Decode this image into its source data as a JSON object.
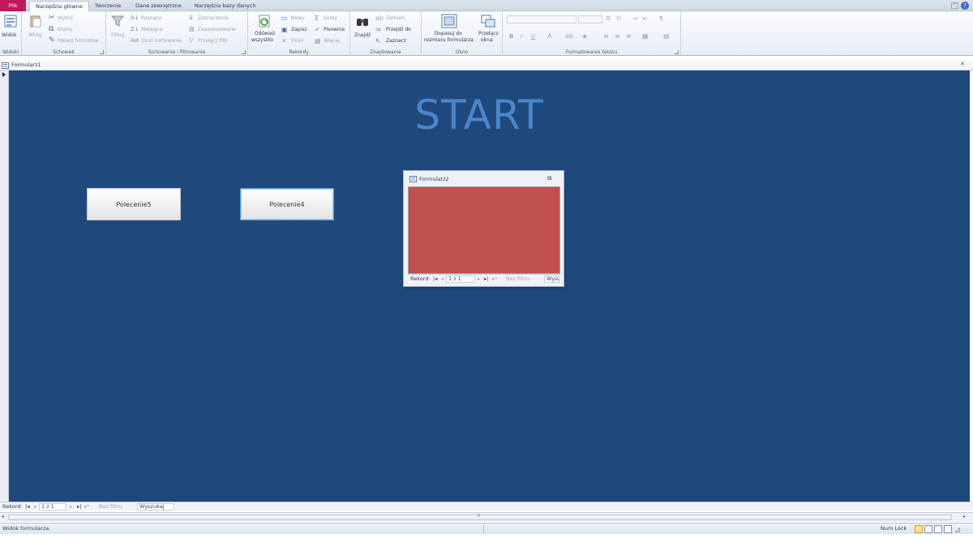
{
  "tabs": {
    "file": "Plik",
    "home": "Narzędzia główne",
    "create": "Tworzenie",
    "external": "Dane zewnętrzne",
    "dbtools": "Narzędzia bazy danych"
  },
  "ribbon": {
    "views": {
      "label": "Widoki",
      "view": "Widok"
    },
    "clipboard": {
      "label": "Schowek",
      "paste": "Wklej",
      "cut": "Wytnij",
      "copy": "Kopiuj",
      "painter": "Malarz formatów"
    },
    "sort": {
      "label": "Sortowanie i filtrowanie",
      "filter": "Filtruj",
      "asc": "Rosnąco",
      "desc": "Malejąco",
      "remove_sort": "Usuń sortowanie",
      "selection": "Zaznaczenie",
      "advanced": "Zaawansowane",
      "toggle": "Przełącz filtr"
    },
    "records": {
      "label": "Rekordy",
      "refresh1": "Odśwież",
      "refresh2": "wszystko",
      "new": "Nowy",
      "save": "Zapisz",
      "delete": "Usuń",
      "totals": "Sumy",
      "spelling": "Pisownia",
      "more": "Więcej"
    },
    "find": {
      "label": "Znajdowanie",
      "find": "Znajdź",
      "replace": "Zamień",
      "goto": "Przejdź do",
      "select": "Zaznacz"
    },
    "window": {
      "label": "Okno",
      "fit1": "Dopasuj do",
      "fit2": "rozmiaru formularza",
      "switch1": "Przełącz",
      "switch2": "okna"
    },
    "text": {
      "label": "Formatowanie tekstu",
      "bold": "B",
      "italic": "I",
      "underline": "U"
    }
  },
  "doc": {
    "tab_title": "Formularz1"
  },
  "form": {
    "title": "START",
    "button1": "Polecenie5",
    "button2": "Polecenie4"
  },
  "subform": {
    "title": "Formularz2",
    "record_label": "Rekord:",
    "record_value": "1 z 1",
    "filter": "Bez filtru",
    "search": "Wysz"
  },
  "navbar": {
    "record_label": "Rekord:",
    "record_value": "1 z 1",
    "filter": "Bez filtru",
    "search": "Wyszukaj"
  },
  "status": {
    "text": "Widok formularza.",
    "numlock": "Num Lock"
  },
  "colors": {
    "canvas": "#1f497d",
    "title": "#4a86c9",
    "subform_body": "#c0504d",
    "file_tab": "#c2185b"
  }
}
